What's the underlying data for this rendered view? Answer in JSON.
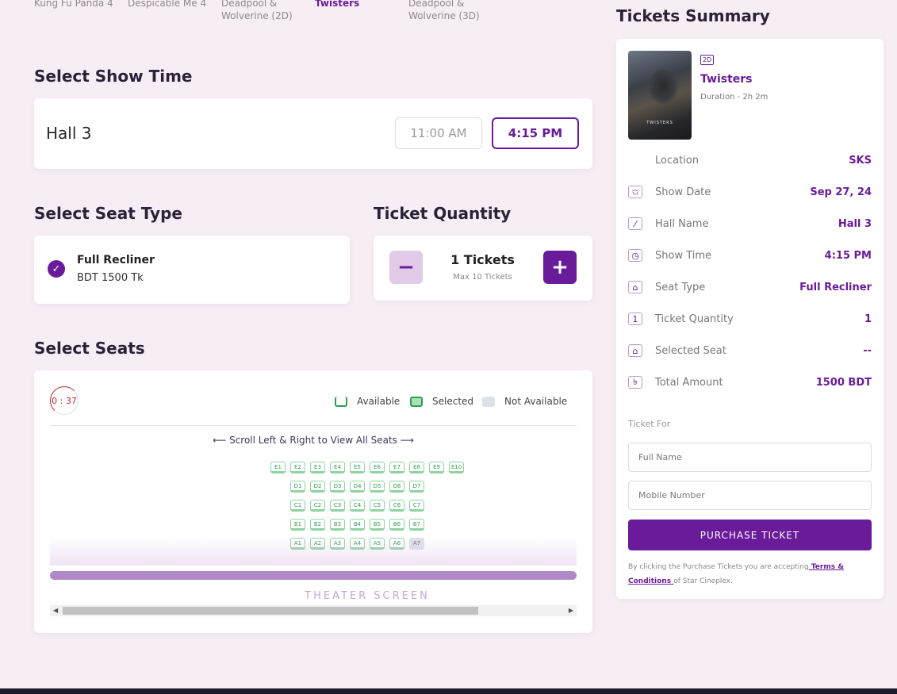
{
  "movies": [
    {
      "title": "Kung Fu Panda 4"
    },
    {
      "title": "Despicable Me 4"
    },
    {
      "title_line1": "Deadpool &",
      "title_line2": "Wolverine (2D)"
    },
    {
      "title": "Twisters"
    },
    {
      "title_line1": "Deadpool &",
      "title_line2": "Wolverine (3D)"
    }
  ],
  "show_time": {
    "heading": "Select Show Time",
    "hall": "Hall 3",
    "times": [
      "11:00 AM",
      "4:15 PM"
    ],
    "selected": "4:15 PM"
  },
  "seat_type": {
    "heading": "Select Seat Type",
    "name": "Full Recliner",
    "price": "BDT 1500 Tk",
    "check_icon": "check-icon"
  },
  "ticket_quantity": {
    "heading": "Ticket Quantity",
    "count_label": "1 Tickets",
    "max_label": "Max 10 Tickets",
    "minus": "−",
    "plus": "+"
  },
  "seats": {
    "heading": "Select Seats",
    "timer": "0 : 37",
    "legend": {
      "available": "Available",
      "selected": "Selected",
      "not_available": "Not Available"
    },
    "scroll_hint": "⟵ Scroll Left & Right to View All Seats ⟶",
    "screen_label": "THEATER SCREEN",
    "rows": [
      {
        "row": "E",
        "seats": [
          "E1",
          "E2",
          "E3",
          "E4",
          "E5",
          "E6",
          "E7",
          "E8",
          "E9",
          "E10"
        ]
      },
      {
        "row": "D",
        "seats": [
          "D1",
          "D2",
          "D3",
          "D4",
          "D5",
          "D6",
          "D7"
        ]
      },
      {
        "row": "C",
        "seats": [
          "C1",
          "C2",
          "C3",
          "C4",
          "C5",
          "C6",
          "C7"
        ]
      },
      {
        "row": "B",
        "seats": [
          "B1",
          "B2",
          "B3",
          "B4",
          "B5",
          "B6",
          "B7"
        ]
      },
      {
        "row": "A",
        "seats": [
          "A1",
          "A2",
          "A3",
          "A4",
          "A5",
          "A6",
          "A7"
        ]
      }
    ],
    "unavailable": [
      "A7"
    ]
  },
  "summary": {
    "heading": "Tickets Summary",
    "format_badge": "2D",
    "movie": "Twisters",
    "duration": "Duration - 2h 2m",
    "poster_title": "TWISTERS",
    "rows": [
      {
        "icon": "location-icon",
        "glyph": "",
        "label": "Location",
        "value": "SKS"
      },
      {
        "icon": "calendar-icon",
        "glyph": "✩",
        "label": "Show Date",
        "value": "Sep 27, 24"
      },
      {
        "icon": "ticket-icon",
        "glyph": "⁄",
        "label": "Hall Name",
        "value": "Hall 3"
      },
      {
        "icon": "clock-icon",
        "glyph": "◷",
        "label": "Show Time",
        "value": "4:15 PM"
      },
      {
        "icon": "seat-icon",
        "glyph": "⌂",
        "label": "Seat Type",
        "value": "Full Recliner"
      },
      {
        "icon": "quantity-icon",
        "glyph": "1",
        "label": "Ticket Quantity",
        "value": "1"
      },
      {
        "icon": "selected-seat-icon",
        "glyph": "⌂",
        "label": "Selected Seat",
        "value": "--"
      },
      {
        "icon": "taka-icon",
        "glyph": "৳",
        "label": "Total Amount",
        "value": "1500 BDT"
      }
    ],
    "ticket_for": "Ticket For",
    "name_placeholder": "Full Name",
    "mobile_placeholder": "Mobile Number",
    "purchase_label": "PURCHASE TICKET",
    "terms_prefix": "By clicking the Purchase Tickets you are accepting",
    "terms_link": " Terms & Conditions ",
    "terms_suffix": "of Star Cineplex."
  }
}
